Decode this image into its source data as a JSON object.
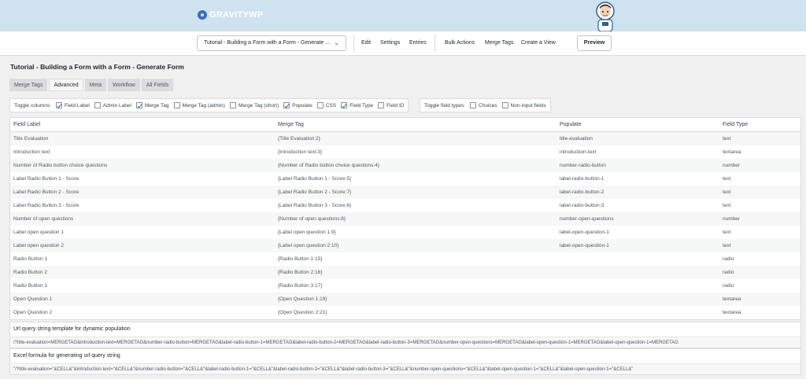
{
  "brand": {
    "logo_text": "GRAVITYWP"
  },
  "toolbar": {
    "form_name": "Tutorial - Building a Form with a Form - Generate ...",
    "links": [
      "Edit",
      "Settings",
      "Entries",
      "Bulk Actions",
      "Merge Tags",
      "Create a View"
    ],
    "preview_label": "Preview"
  },
  "page_title": "Tutorial - Building a Form with a Form - Generate Form",
  "tabs": [
    {
      "label": "Merge Tags",
      "active": false
    },
    {
      "label": "Advanced",
      "active": true
    },
    {
      "label": "Meta",
      "active": false
    },
    {
      "label": "Workflow",
      "active": false
    },
    {
      "label": "All Fields",
      "active": false
    }
  ],
  "toggle_columns": {
    "label": "Toggle columns:",
    "options": [
      {
        "label": "Field Label",
        "checked": true
      },
      {
        "label": "Admin Label",
        "checked": false
      },
      {
        "label": "Merge Tag",
        "checked": true
      },
      {
        "label": "Merge Tag (admin)",
        "checked": false
      },
      {
        "label": "Merge Tag (short)",
        "checked": false
      },
      {
        "label": "Populate",
        "checked": true
      },
      {
        "label": "CSS",
        "checked": false
      },
      {
        "label": "Field Type",
        "checked": true
      },
      {
        "label": "Field ID",
        "checked": false
      }
    ]
  },
  "toggle_field_types": {
    "label": "Toggle field types:",
    "options": [
      {
        "label": "Choices",
        "checked": false
      },
      {
        "label": "Non-input fields",
        "checked": false
      }
    ]
  },
  "table": {
    "headers": [
      "Field Label",
      "Merge Tag",
      "Populate",
      "Field Type"
    ],
    "rows": [
      [
        "Title Evaluation",
        "{Title Evaluation:2}",
        "title-evaluation",
        "text"
      ],
      [
        "Introduction text",
        "{Introduction text:3}",
        "introduction-text",
        "textarea"
      ],
      [
        "Number of Radio button choice questions",
        "{Number of Radio button choice questions:4}",
        "number-radio-button",
        "number"
      ],
      [
        "Label Radio Button 1 - Score",
        "{Label Radio Button 1 - Score:5}",
        "label-radio-button-1",
        "text"
      ],
      [
        "Label Radio Button 2 - Score",
        "{Label Radio Button 2 - Score:7}",
        "label-radio-button-2",
        "text"
      ],
      [
        "Label Radio Button 3 - Score",
        "{Label Radio Button 3 - Score:6}",
        "label-radio-button-3",
        "text"
      ],
      [
        "Number of open questions",
        "{Number of open questions:8}",
        "number-open-questions",
        "number"
      ],
      [
        "Label open question 1",
        "{Label open question 1:9}",
        "label-open-question-1",
        "text"
      ],
      [
        "Label open question 2",
        "{Label open question 2:10}",
        "label-open-question-1",
        "text"
      ],
      [
        "Radio Button 1",
        "{Radio Button 1:15}",
        "",
        "radio"
      ],
      [
        "Radio Button 2",
        "{Radio Button 2:16}",
        "",
        "radio"
      ],
      [
        "Radio Button 3",
        "{Radio Button 3:17}",
        "",
        "radio"
      ],
      [
        "Open Question 1",
        "{Open Question 1:19}",
        "",
        "textarea"
      ],
      [
        "Open Question 2",
        "{Open Question 2:21}",
        "",
        "textarea"
      ]
    ]
  },
  "url_template": {
    "title": "Url query string template for dynamic population",
    "value": "/?title-evaluation=MERGETAG&introduction-text=MERGETAG&number-radio-button=MERGETAG&label-radio-button-1=MERGETAG&label-radio-button-2=MERGETAG&label-radio-button-3=MERGETAG&number-open-questions=MERGETAG&label-open-question-1=MERGETAG&label-open-question-1=MERGETAG"
  },
  "excel_formula": {
    "title": "Excel formula for generating url query string",
    "value": "\"/?title-evaluation=\"&CELL&\"&introduction-text=\"&CELL&\"&number-radio-button=\"&CELL&\"&label-radio-button-1=\"&CELL&\"&label-radio-button-2=\"&CELL&\"&label-radio-button-3=\"&CELL&\"&number-open-questions=\"&CELL&\"&label-open-question-1=\"&CELL&\"&label-open-question-1=\"&CELL&\""
  }
}
